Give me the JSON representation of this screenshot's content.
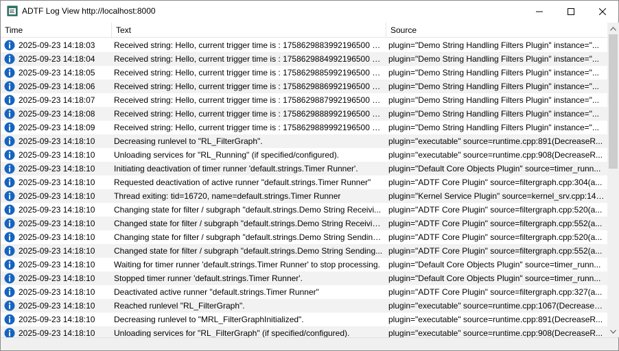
{
  "window": {
    "title": "ADTF Log View http://localhost:8000",
    "icons": {
      "app": "log-view-app-icon",
      "minimize": "minimize-icon",
      "maximize": "maximize-icon",
      "close": "close-icon"
    }
  },
  "table": {
    "columns": {
      "time": "Time",
      "text": "Text",
      "source": "Source"
    },
    "row_icon": "info-icon",
    "rows": [
      {
        "time": "2025-09-23 14:18:03",
        "text": "Received string: Hello, current trigger time is : 1758629883992196500 nan...",
        "source": "plugin=\"Demo String Handling Filters Plugin\" instance=\"..."
      },
      {
        "time": "2025-09-23 14:18:04",
        "text": "Received string: Hello, current trigger time is : 1758629884992196500 nan...",
        "source": "plugin=\"Demo String Handling Filters Plugin\" instance=\"..."
      },
      {
        "time": "2025-09-23 14:18:05",
        "text": "Received string: Hello, current trigger time is : 1758629885992196500 nan...",
        "source": "plugin=\"Demo String Handling Filters Plugin\" instance=\"..."
      },
      {
        "time": "2025-09-23 14:18:06",
        "text": "Received string: Hello, current trigger time is : 1758629886992196500 nan...",
        "source": "plugin=\"Demo String Handling Filters Plugin\" instance=\"..."
      },
      {
        "time": "2025-09-23 14:18:07",
        "text": "Received string: Hello, current trigger time is : 1758629887992196500 nan...",
        "source": "plugin=\"Demo String Handling Filters Plugin\" instance=\"..."
      },
      {
        "time": "2025-09-23 14:18:08",
        "text": "Received string: Hello, current trigger time is : 1758629888992196500 nan...",
        "source": "plugin=\"Demo String Handling Filters Plugin\" instance=\"..."
      },
      {
        "time": "2025-09-23 14:18:09",
        "text": "Received string: Hello, current trigger time is : 1758629889992196500 nan...",
        "source": "plugin=\"Demo String Handling Filters Plugin\" instance=\"..."
      },
      {
        "time": "2025-09-23 14:18:10",
        "text": "Decreasing runlevel to \"RL_FilterGraph\".",
        "source": "plugin=\"executable\" source=runtime.cpp:891(DecreaseR..."
      },
      {
        "time": "2025-09-23 14:18:10",
        "text": "Unloading services for \"RL_Running\" (if specified/configured).",
        "source": "plugin=\"executable\" source=runtime.cpp:908(DecreaseR..."
      },
      {
        "time": "2025-09-23 14:18:10",
        "text": "Initiating deactivation of timer runner 'default.strings.Timer Runner'.",
        "source": "plugin=\"Default Core Objects Plugin\" source=timer_runn..."
      },
      {
        "time": "2025-09-23 14:18:10",
        "text": "Requested deactivation of active runner \"default.strings.Timer Runner\"",
        "source": "plugin=\"ADTF Core Plugin\" source=filtergraph.cpp:304(a..."
      },
      {
        "time": "2025-09-23 14:18:10",
        "text": "Thread exiting: tid=16720, name=default.strings.Timer Runner",
        "source": "plugin=\"Kernel Service Plugin\" source=kernel_srv.cpp:140..."
      },
      {
        "time": "2025-09-23 14:18:10",
        "text": "Changing state for filter / subgraph \"default.strings.Demo String Receivi...",
        "source": "plugin=\"ADTF Core Plugin\" source=filtergraph.cpp:520(a..."
      },
      {
        "time": "2025-09-23 14:18:10",
        "text": "Changed state for filter / subgraph \"default.strings.Demo String Receivin...",
        "source": "plugin=\"ADTF Core Plugin\" source=filtergraph.cpp:552(a..."
      },
      {
        "time": "2025-09-23 14:18:10",
        "text": "Changing state for filter / subgraph \"default.strings.Demo String Sending...",
        "source": "plugin=\"ADTF Core Plugin\" source=filtergraph.cpp:520(a..."
      },
      {
        "time": "2025-09-23 14:18:10",
        "text": "Changed state for filter / subgraph \"default.strings.Demo String Sending...",
        "source": "plugin=\"ADTF Core Plugin\" source=filtergraph.cpp:552(a..."
      },
      {
        "time": "2025-09-23 14:18:10",
        "text": "Waiting for timer runner 'default.strings.Timer Runner' to stop processing.",
        "source": "plugin=\"Default Core Objects Plugin\" source=timer_runn..."
      },
      {
        "time": "2025-09-23 14:18:10",
        "text": "Stopped timer runner 'default.strings.Timer Runner'.",
        "source": "plugin=\"Default Core Objects Plugin\" source=timer_runn..."
      },
      {
        "time": "2025-09-23 14:18:10",
        "text": "Deactivated active runner \"default.strings.Timer Runner\"",
        "source": "plugin=\"ADTF Core Plugin\" source=filtergraph.cpp:327(a..."
      },
      {
        "time": "2025-09-23 14:18:10",
        "text": "Reached runlevel \"RL_FilterGraph\".",
        "source": "plugin=\"executable\" source=runtime.cpp:1067(DecreaseR..."
      },
      {
        "time": "2025-09-23 14:18:10",
        "text": "Decreasing runlevel to \"MRL_FilterGraphInitialized\".",
        "source": "plugin=\"executable\" source=runtime.cpp:891(DecreaseR..."
      },
      {
        "time": "2025-09-23 14:18:10",
        "text": "Unloading services for \"RL_FilterGraph\" (if specified/configured).",
        "source": "plugin=\"executable\" source=runtime.cpp:908(DecreaseR..."
      }
    ]
  },
  "scrollbar": {
    "up_icon": "chevron-up-icon",
    "down_icon": "chevron-down-icon"
  },
  "colors": {
    "info_icon": "#1565c0",
    "alt_row": "#f2f2f2",
    "scroll_thumb": "#cdcdcd"
  }
}
